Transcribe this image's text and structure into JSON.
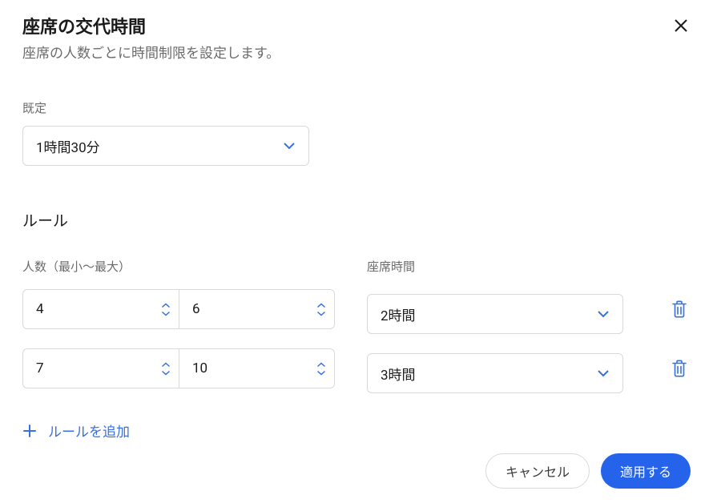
{
  "header": {
    "title": "座席の交代時間",
    "subtitle": "座席の人数ごとに時間制限を設定します。"
  },
  "default_section": {
    "label": "既定",
    "value": "1時間30分"
  },
  "rules_section": {
    "heading": "ルール",
    "people_label": "人数（最小〜最大）",
    "time_label": "座席時間",
    "rows": [
      {
        "min": "4",
        "max": "6",
        "time": "2時間"
      },
      {
        "min": "7",
        "max": "10",
        "time": "3時間"
      }
    ],
    "add_label": "ルールを追加"
  },
  "footer": {
    "cancel": "キャンセル",
    "apply": "適用する"
  },
  "colors": {
    "accent": "#2563eb"
  }
}
